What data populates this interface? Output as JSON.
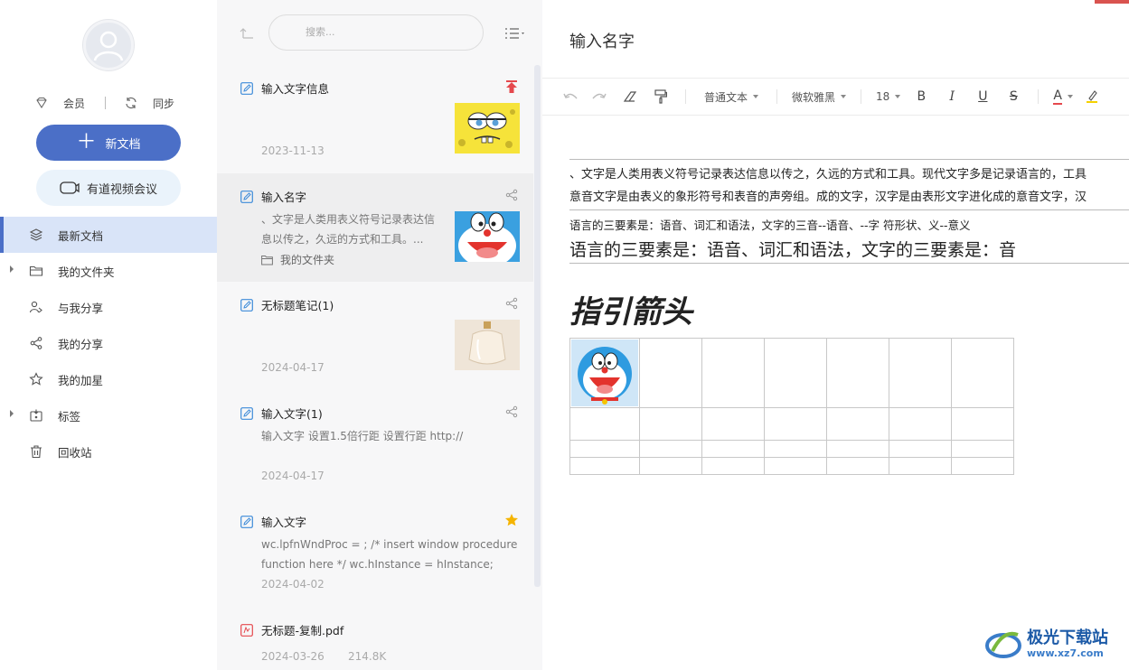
{
  "sidebar": {
    "vip_label": "会员",
    "sync_label": "同步",
    "new_doc_label": "新文档",
    "meeting_label": "有道视频会议",
    "nav": [
      {
        "label": "最新文档",
        "icon": "layers-icon",
        "active": true
      },
      {
        "label": "我的文件夹",
        "icon": "folder-icon",
        "expandable": true
      },
      {
        "label": "与我分享",
        "icon": "shared-with-me-icon"
      },
      {
        "label": "我的分享",
        "icon": "share-icon"
      },
      {
        "label": "我的加星",
        "icon": "star-icon"
      },
      {
        "label": "标签",
        "icon": "tag-icon",
        "expandable": true
      },
      {
        "label": "回收站",
        "icon": "trash-icon"
      }
    ]
  },
  "list": {
    "search_placeholder": "搜索...",
    "notes": [
      {
        "title": "输入文字信息",
        "date": "2023-11-13",
        "badge": "pin-top-icon",
        "thumb": "spongebob-thumbnail"
      },
      {
        "title": "输入名字",
        "preview": "、文字是人类用表义符号记录表达信息以传之，久远的方式和工具。...",
        "folder": "我的文件夹",
        "badge": "share-icon",
        "thumb": "doraemon-thumbnail",
        "selected": true
      },
      {
        "title": "无标题笔记(1)",
        "date": "2024-04-17",
        "badge": "share-icon",
        "thumb": "perfume-bottle-thumbnail"
      },
      {
        "title": "输入文字(1)",
        "preview": "输入文字 设置1.5倍行距 设置行距 http://",
        "date": "2024-04-17",
        "badge": "share-icon"
      },
      {
        "title": "输入文字",
        "preview": "wc.lpfnWndProc = ; /* insert window procedure function here */ wc.hInstance = hInstance; wc.h...",
        "date": "2024-04-02",
        "badge": "star-filled-icon"
      },
      {
        "title": "无标题-复制.pdf",
        "date": "2024-03-26",
        "size": "214.8K",
        "icon": "pdf-icon"
      }
    ]
  },
  "editor": {
    "title": "输入名字",
    "toolbar": {
      "style": "普通文本",
      "font": "微软雅黑",
      "size": "18",
      "bold": "B",
      "italic": "I",
      "underline": "U",
      "strike": "S",
      "color": "A"
    },
    "lines": {
      "p1": "、文字是人类用表义符号记录表达信息以传之，久远的方式和工具。现代文字多是记录语言的，工具",
      "p2": "意音文字是由表义的象形符号和表音的声旁组。成的文字，汉字是由表形文字进化成的意音文字，汉",
      "p3": "语言的三要素是：语音、词汇和语法，文字的三音--语音、--字 符形状、义--意义",
      "p4": "语言的三要素是：语音、词汇和语法，文字的三要素是：音",
      "heading": "指引箭头"
    },
    "table": {
      "rows": 4,
      "cols": 7,
      "image": "doraemon-image"
    }
  },
  "watermark": {
    "text": "极光下载站",
    "url": "www.xz7.com"
  },
  "colors": {
    "accent": "#4b6fc7",
    "nav_active_bg": "#d9e4f8",
    "pin_red": "#e5484d",
    "star_yellow": "#f5b400"
  }
}
